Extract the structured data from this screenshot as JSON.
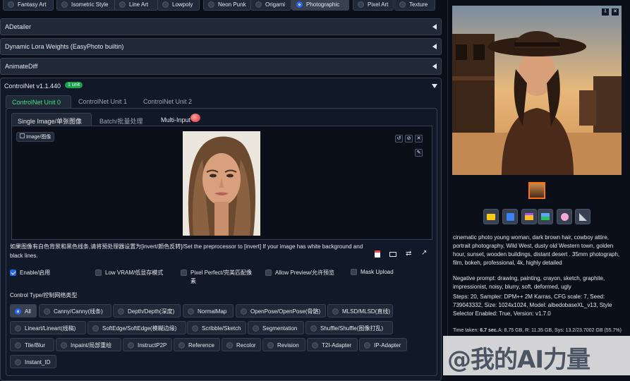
{
  "styles_row": {
    "options": [
      {
        "label": "Fantasy Art",
        "selected": false
      },
      {
        "label": "Isometric Style",
        "selected": false
      },
      {
        "label": "Line Art",
        "selected": false
      },
      {
        "label": "Lowpoly",
        "selected": false
      },
      {
        "label": "Neon Punk",
        "selected": false
      },
      {
        "label": "Origami",
        "selected": false
      },
      {
        "label": "Photographic",
        "selected": true
      },
      {
        "label": "Pixel Art",
        "selected": false
      },
      {
        "label": "Texture",
        "selected": false
      }
    ]
  },
  "sections": {
    "adetailer": "ADetailer",
    "dynamic_lora": "Dynamic Lora Weights (EasyPhoto builtin)",
    "animatediff": "AnimateDiff",
    "controlnet": "ControlNet v1.1.440",
    "controlnet_badge": "1 unit"
  },
  "unit_tabs": [
    "ControlNet Unit 0",
    "ControlNet Unit 1",
    "ControlNet Unit 2"
  ],
  "image_tabs": [
    "Single Image/单张图像",
    "Batch/批量处理",
    "Multi-Input"
  ],
  "image_box": {
    "label": "Image/图像",
    "buttons": [
      "↺",
      "⊘",
      "✕"
    ]
  },
  "hint_text": "如果图像有白色背景和黑色线条,请将预处理器设置为[invert/颜色反转]/Set the preprocessor to [invert] If your image has white background and black lines.",
  "options": {
    "enable": {
      "label": "Enable/启用",
      "checked": true
    },
    "low_vram": {
      "label": "Low VRAM/低显存模式",
      "checked": false
    },
    "pixel_perfect": {
      "label": "Pixel Perfect/完美匹配像素",
      "checked": false
    },
    "allow_preview": {
      "label": "Allow Preview/允许预览",
      "checked": false
    },
    "mask_upload": {
      "label": "Mask Upload",
      "checked": false
    }
  },
  "control_type": {
    "title": "Control Type/控制网络类型",
    "rows": [
      [
        {
          "label": "All",
          "selected": true
        },
        {
          "label": "Canny/Canny(线条)",
          "selected": false
        },
        {
          "label": "Depth/Depth(深度)",
          "selected": false
        },
        {
          "label": "NormalMap",
          "selected": false
        },
        {
          "label": "OpenPose/OpenPose(骨骼)",
          "selected": false
        },
        {
          "label": "MLSD/MLSD(直线)",
          "selected": false
        }
      ],
      [
        {
          "label": "Lineart/Lineart(线稿)",
          "selected": false
        },
        {
          "label": "SoftEdge/SoftEdge(模糊边缘)",
          "selected": false
        },
        {
          "label": "Scribble/Sketch",
          "selected": false
        },
        {
          "label": "Segmentation",
          "selected": false
        },
        {
          "label": "Shuffle/Shuffle(图像打乱)",
          "selected": false
        }
      ],
      [
        {
          "label": "Tile/Blur",
          "selected": false
        },
        {
          "label": "Inpaint/局部重绘",
          "selected": false
        },
        {
          "label": "InstructP2P",
          "selected": false
        },
        {
          "label": "Reference",
          "selected": false
        },
        {
          "label": "Recolor",
          "selected": false
        },
        {
          "label": "Revision",
          "selected": false
        },
        {
          "label": "T2I-Adapter",
          "selected": false
        },
        {
          "label": "IP-Adapter",
          "selected": false
        }
      ],
      [
        {
          "label": "Instant_ID",
          "selected": false
        }
      ]
    ]
  },
  "output": {
    "prompt": "cinematic photo young woman, dark brown hair, cowboy attire, portrait photography, Wild West, dusty old Western town, golden hour, sunset, wooden buildings, distant desert . 35mm photograph, film, bokeh, professional, 4k, highly detailed",
    "negative": "Negative prompt: drawing, painting, crayon, sketch, graphite, impressionist, noisy, blurry, soft, deformed, ugly",
    "params": "Steps: 20, Sampler: DPM++ 2M Karras, CFG scale: 7, Seed: 739043332, Size: 1024x1024, Model: albedobaseXL_v13, Style Selector Enabled: True, Version: v1.7.0",
    "time_taken_label": "Time taken:",
    "time_taken": "6.7 sec.",
    "vram": "A: 8.75 GB, R: 11.35 GB, Sys: 13.2/23.7002 GB (55.7%)",
    "tools": [
      "folder-icon",
      "save-icon",
      "zip-icon",
      "image-icon",
      "palette-icon",
      "ruler-icon"
    ]
  },
  "watermark": "@我的AI力量",
  "colors": {
    "accent_green": "#4ade80",
    "badge_green": "#16a34a",
    "selected_blue": "#2563eb"
  }
}
